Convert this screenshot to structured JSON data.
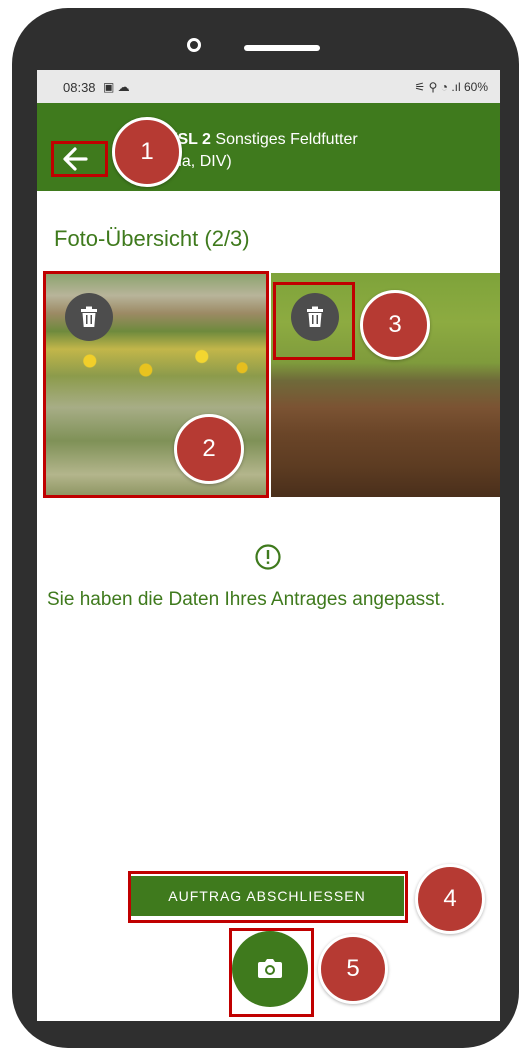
{
  "statusbar": {
    "time": "08:38",
    "left_icons": "▣ ☁",
    "right_status": "⚟ ⚲ ◔ .ıl 60%"
  },
  "appbar": {
    "title_bold": "/SL 2",
    "title_rest": " Sonstiges Feldfutter",
    "title_line2": "ha, DIV)"
  },
  "section": {
    "title": "Foto-Übersicht (2/3)"
  },
  "notice": {
    "text": "Sie haben die Daten Ihres Antrages angepasst."
  },
  "actions": {
    "finish_label": "AUFTRAG ABSCHLIESSEN"
  },
  "annotations": [
    "1",
    "2",
    "3",
    "4",
    "5"
  ],
  "colors": {
    "primary": "#3f7a1d",
    "annotation_box": "#c00000",
    "annotation_badge": "#b63a33"
  },
  "icons": {
    "back": "arrow-left-icon",
    "delete": "trash-icon",
    "camera": "camera-icon",
    "notice": "exclamation-circle-icon"
  }
}
